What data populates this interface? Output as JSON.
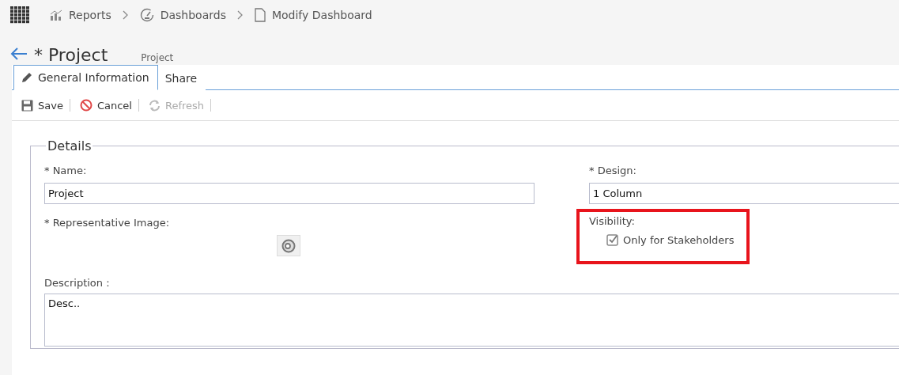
{
  "breadcrumbs": [
    {
      "label": "Reports"
    },
    {
      "label": "Dashboards"
    },
    {
      "label": "Modify Dashboard"
    }
  ],
  "title": "* Project",
  "subtitle": "Project",
  "tabs": [
    {
      "label": "General Information",
      "selected": true
    },
    {
      "label": "Share",
      "selected": false
    }
  ],
  "toolbar": [
    {
      "label": "Save",
      "disabled": false
    },
    {
      "label": "Cancel",
      "disabled": false
    },
    {
      "label": "Refresh",
      "disabled": true
    }
  ],
  "details": {
    "legend": "Details",
    "name_label": "* Name:",
    "name_value": "Project",
    "design_label": "* Design:",
    "design_value": "1 Column",
    "image_label": "* Representative Image:",
    "visibility_label": "Visibility:",
    "visibility_option": {
      "label": "Only for Stakeholders",
      "checked": true
    },
    "description_label": "Description :",
    "description_value": "Desc.."
  }
}
